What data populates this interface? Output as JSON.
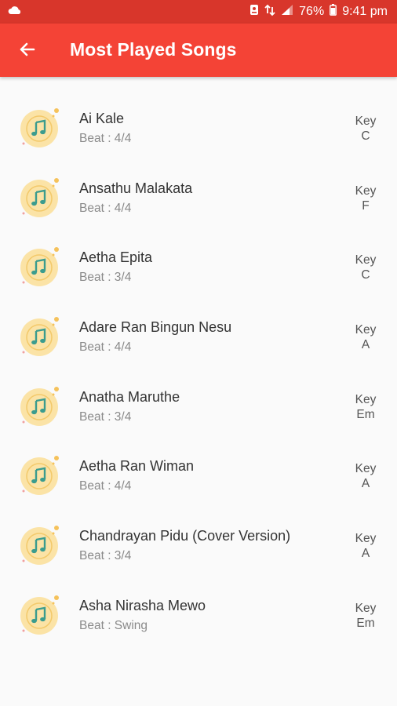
{
  "status_bar": {
    "battery_percent": "76%",
    "time": "9:41 pm"
  },
  "app_bar": {
    "title": "Most Played Songs",
    "back_icon": "arrow-left-icon"
  },
  "list": {
    "key_label": "Key",
    "songs": [
      {
        "title": "Ai Kale",
        "beat": "Beat : 4/4",
        "key": "C"
      },
      {
        "title": "Ansathu Malakata",
        "beat": "Beat : 4/4",
        "key": "F"
      },
      {
        "title": "Aetha Epita",
        "beat": "Beat : 3/4",
        "key": "C"
      },
      {
        "title": "Adare Ran Bingun Nesu",
        "beat": "Beat : 4/4",
        "key": "A"
      },
      {
        "title": "Anatha Maruthe",
        "beat": "Beat : 3/4",
        "key": "Em"
      },
      {
        "title": "Aetha Ran Wiman",
        "beat": "Beat : 4/4",
        "key": "A"
      },
      {
        "title": "Chandrayan Pidu (Cover Version)",
        "beat": "Beat : 3/4",
        "key": "A"
      },
      {
        "title": "Asha Nirasha Mewo",
        "beat": "Beat : Swing",
        "key": "Em"
      }
    ]
  },
  "colors": {
    "status_bar": "#d8362b",
    "app_bar": "#f44336",
    "icon_circle": "#fbe3a6",
    "icon_note": "#3b9c8e"
  }
}
